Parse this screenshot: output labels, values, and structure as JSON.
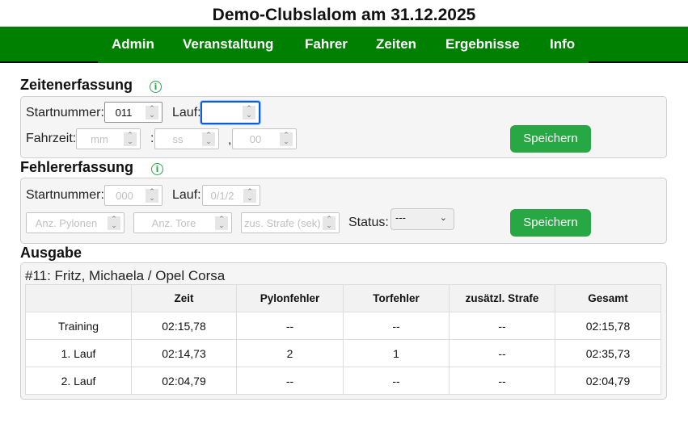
{
  "page_title": "Demo-Clubslalom am 31.12.2025",
  "nav": [
    "Admin",
    "Veranstaltung",
    "Fahrer",
    "Zeiten",
    "Ergebnisse",
    "Info"
  ],
  "zeiten": {
    "heading": "Zeitenerfassung",
    "info_icon": "i",
    "startnummer_label": "Startnummer:",
    "startnummer_value": "011",
    "lauf_label": "Lauf:",
    "lauf_value": "",
    "fahrzeit_label": "Fahrzeit:",
    "mm_placeholder": "mm",
    "sep1": ":",
    "ss_placeholder": "ss",
    "sep2": ",",
    "hh_placeholder": "00",
    "save_label": "Speichern"
  },
  "fehler": {
    "heading": "Fehlererfassung",
    "info_icon": "i",
    "startnummer_label": "Startnummer:",
    "startnummer_placeholder": "000",
    "lauf_label": "Lauf:",
    "lauf_placeholder": "0/1/2",
    "pylonen_placeholder": "Anz. Pylonen",
    "tore_placeholder": "Anz. Tore",
    "strafe_placeholder": "zus. Strafe (sek)",
    "status_label": "Status:",
    "status_value": "---",
    "save_label": "Speichern"
  },
  "ausgabe": {
    "heading": "Ausgabe",
    "driver": "#11: Fritz, Michaela / Opel Corsa",
    "columns": [
      "",
      "Zeit",
      "Pylonfehler",
      "Torfehler",
      "zusätzl. Strafe",
      "Gesamt"
    ],
    "rows": [
      [
        "Training",
        "02:15,78",
        "--",
        "--",
        "--",
        "02:15,78"
      ],
      [
        "1. Lauf",
        "02:14,73",
        "2",
        "1",
        "--",
        "02:35,73"
      ],
      [
        "2. Lauf",
        "02:04,79",
        "--",
        "--",
        "--",
        "02:04,79"
      ]
    ]
  }
}
